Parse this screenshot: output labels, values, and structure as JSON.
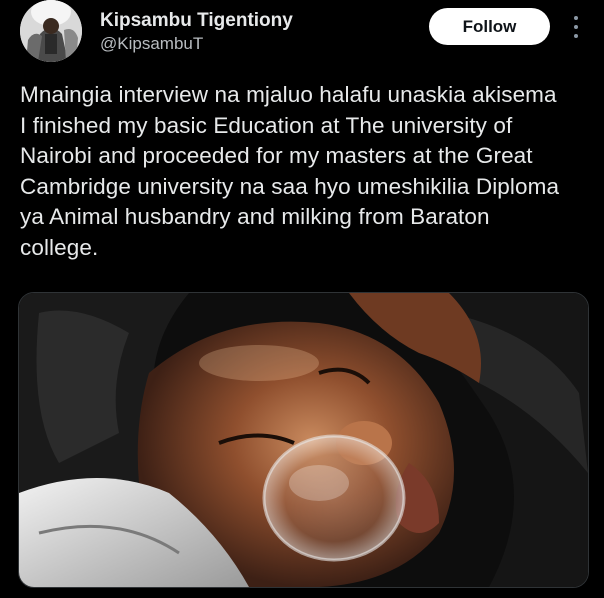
{
  "author": {
    "display_name": "Kipsambu Tigentiony",
    "handle": "@KipsambuT"
  },
  "actions": {
    "follow_label": "Follow",
    "more_icon": "more-vertical-icon"
  },
  "tweet": {
    "text": "Mnaingia interview na mjaluo halafu unaskia akisema\nI finished my basic Education at The university of\nNairobi and proceeded for my masters at the Great\nCambridge university na saa hyo umeshikilia Diploma\nya Animal husbandry and milking from Baraton\ncollege."
  },
  "colors": {
    "background": "#000000",
    "text_primary": "#e7e9ea",
    "text_secondary": "#b8bcc0",
    "follow_bg": "#ffffff",
    "follow_text": "#0f1419"
  }
}
